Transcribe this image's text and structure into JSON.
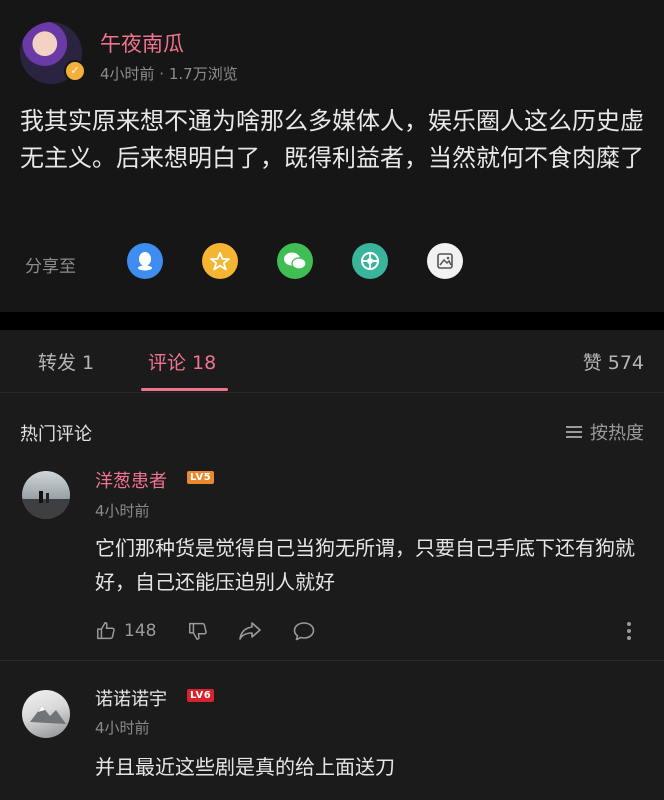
{
  "post": {
    "author": "午夜南瓜",
    "meta": "4小时前 · 1.7万浏览",
    "body": "我其实原来想不通为啥那么多媒体人，娱乐圈人这么历史虚无主义。后来想明白了，既得利益者，当然就何不食肉糜了",
    "share_label": "分享至",
    "share_targets": [
      "qq-icon",
      "qzone-icon",
      "wechat-icon",
      "moments-icon",
      "save-image-icon"
    ]
  },
  "tabs": {
    "repost": "转发 1",
    "comments": "评论 18",
    "likes": "赞 574"
  },
  "comments_section": {
    "title": "热门评论",
    "sort_label": "按热度",
    "items": [
      {
        "name": "洋葱患者",
        "level": "LV5",
        "level_color": "#e8892d",
        "time": "4小时前",
        "text": "它们那种货是觉得自己当狗无所谓，只要自己手底下还有狗就好，自己还能压迫别人就好",
        "likes": "148"
      },
      {
        "name": "诺诺诺宇",
        "level": "LV6",
        "level_color": "#d8232e",
        "time": "4小时前",
        "text": "并且最近这些剧是真的给上面送刀"
      }
    ]
  },
  "colors": {
    "accent": "#f0738f",
    "background": "#161616",
    "qq": "#3d8ef0",
    "qzone": "#f4b533",
    "wechat": "#3fbe54",
    "moments": "#39b59c"
  }
}
